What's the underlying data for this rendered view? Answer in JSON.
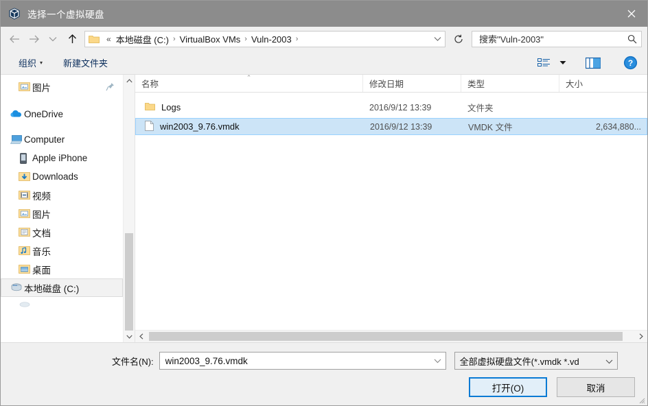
{
  "window": {
    "title": "选择一个虚拟硬盘",
    "icon": "virtualbox-cube-icon",
    "close_label": "✕"
  },
  "nav": {
    "back_icon": "arrow-left-icon",
    "forward_icon": "arrow-right-icon",
    "recent_icon": "chevron-down-icon",
    "up_icon": "arrow-up-icon",
    "refresh_icon": "refresh-icon",
    "dropdown_icon": "chevron-down-icon"
  },
  "breadcrumb": {
    "overflow": "«",
    "separator": "›",
    "items": [
      {
        "label": "本地磁盘 (C:)"
      },
      {
        "label": "VirtualBox VMs"
      },
      {
        "label": "Vuln-2003"
      }
    ]
  },
  "search": {
    "placeholder": "搜索\"Vuln-2003\"",
    "value": "",
    "icon": "search-icon"
  },
  "toolbar": {
    "organize_label": "组织",
    "organize_caret": "▾",
    "new_folder_label": "新建文件夹",
    "view_icon": "view-list-icon",
    "view_caret": "▾",
    "preview_icon": "preview-pane-icon",
    "help_icon": "help-icon"
  },
  "sidebar": {
    "items": [
      {
        "label": "图片",
        "icon": "pictures-folder-icon",
        "indent": true,
        "pinned": true,
        "selected": false
      },
      {
        "label": "OneDrive",
        "icon": "onedrive-cloud-icon",
        "indent": false,
        "pinned": false,
        "selected": false
      },
      {
        "label": "Computer",
        "icon": "computer-icon",
        "indent": false,
        "pinned": false,
        "selected": false
      },
      {
        "label": "Apple iPhone",
        "icon": "phone-device-icon",
        "indent": true,
        "pinned": false,
        "selected": false
      },
      {
        "label": "Downloads",
        "icon": "downloads-folder-icon",
        "indent": true,
        "pinned": false,
        "selected": false
      },
      {
        "label": "视频",
        "icon": "videos-folder-icon",
        "indent": true,
        "pinned": false,
        "selected": false
      },
      {
        "label": "图片",
        "icon": "pictures-folder-icon",
        "indent": true,
        "pinned": false,
        "selected": false
      },
      {
        "label": "文档",
        "icon": "documents-folder-icon",
        "indent": true,
        "pinned": false,
        "selected": false
      },
      {
        "label": "音乐",
        "icon": "music-folder-icon",
        "indent": true,
        "pinned": false,
        "selected": false
      },
      {
        "label": "桌面",
        "icon": "desktop-folder-icon",
        "indent": true,
        "pinned": false,
        "selected": false
      },
      {
        "label": "本地磁盘 (C:)",
        "icon": "hard-disk-icon",
        "indent": true,
        "pinned": false,
        "selected": true
      }
    ],
    "scroll_up_icon": "chevron-up-icon",
    "scroll_down_icon": "chevron-down-icon"
  },
  "filelist": {
    "columns": [
      {
        "label": "名称",
        "sorted": "asc",
        "sort_caret": "⌃"
      },
      {
        "label": "修改日期",
        "sorted": ""
      },
      {
        "label": "类型",
        "sorted": ""
      },
      {
        "label": "大小",
        "sorted": ""
      }
    ],
    "rows": [
      {
        "name": "Logs",
        "date": "2016/9/12 13:39",
        "type": "文件夹",
        "size": "",
        "icon": "folder-icon",
        "selected": false
      },
      {
        "name": "win2003_9.76.vmdk",
        "date": "2016/9/12 13:39",
        "type": "VMDK 文件",
        "size": "2,634,880...",
        "icon": "file-icon",
        "selected": true
      }
    ],
    "hscroll_left_icon": "chevron-left-icon",
    "hscroll_right_icon": "chevron-right-icon"
  },
  "footer": {
    "filename_label": "文件名(N):",
    "filename_value": "win2003_9.76.vmdk",
    "filename_placeholder": "",
    "filename_caret": "⌄",
    "filter_value": "全部虚拟硬盘文件(*.vmdk *.vd",
    "filter_caret": "⌄",
    "open_label": "打开(O)",
    "cancel_label": "取消"
  },
  "colors": {
    "titlebar": "#8c8c8c",
    "selection": "#cce4f7",
    "accent": "#0a7ad4",
    "chrome": "#f0f0f0"
  }
}
